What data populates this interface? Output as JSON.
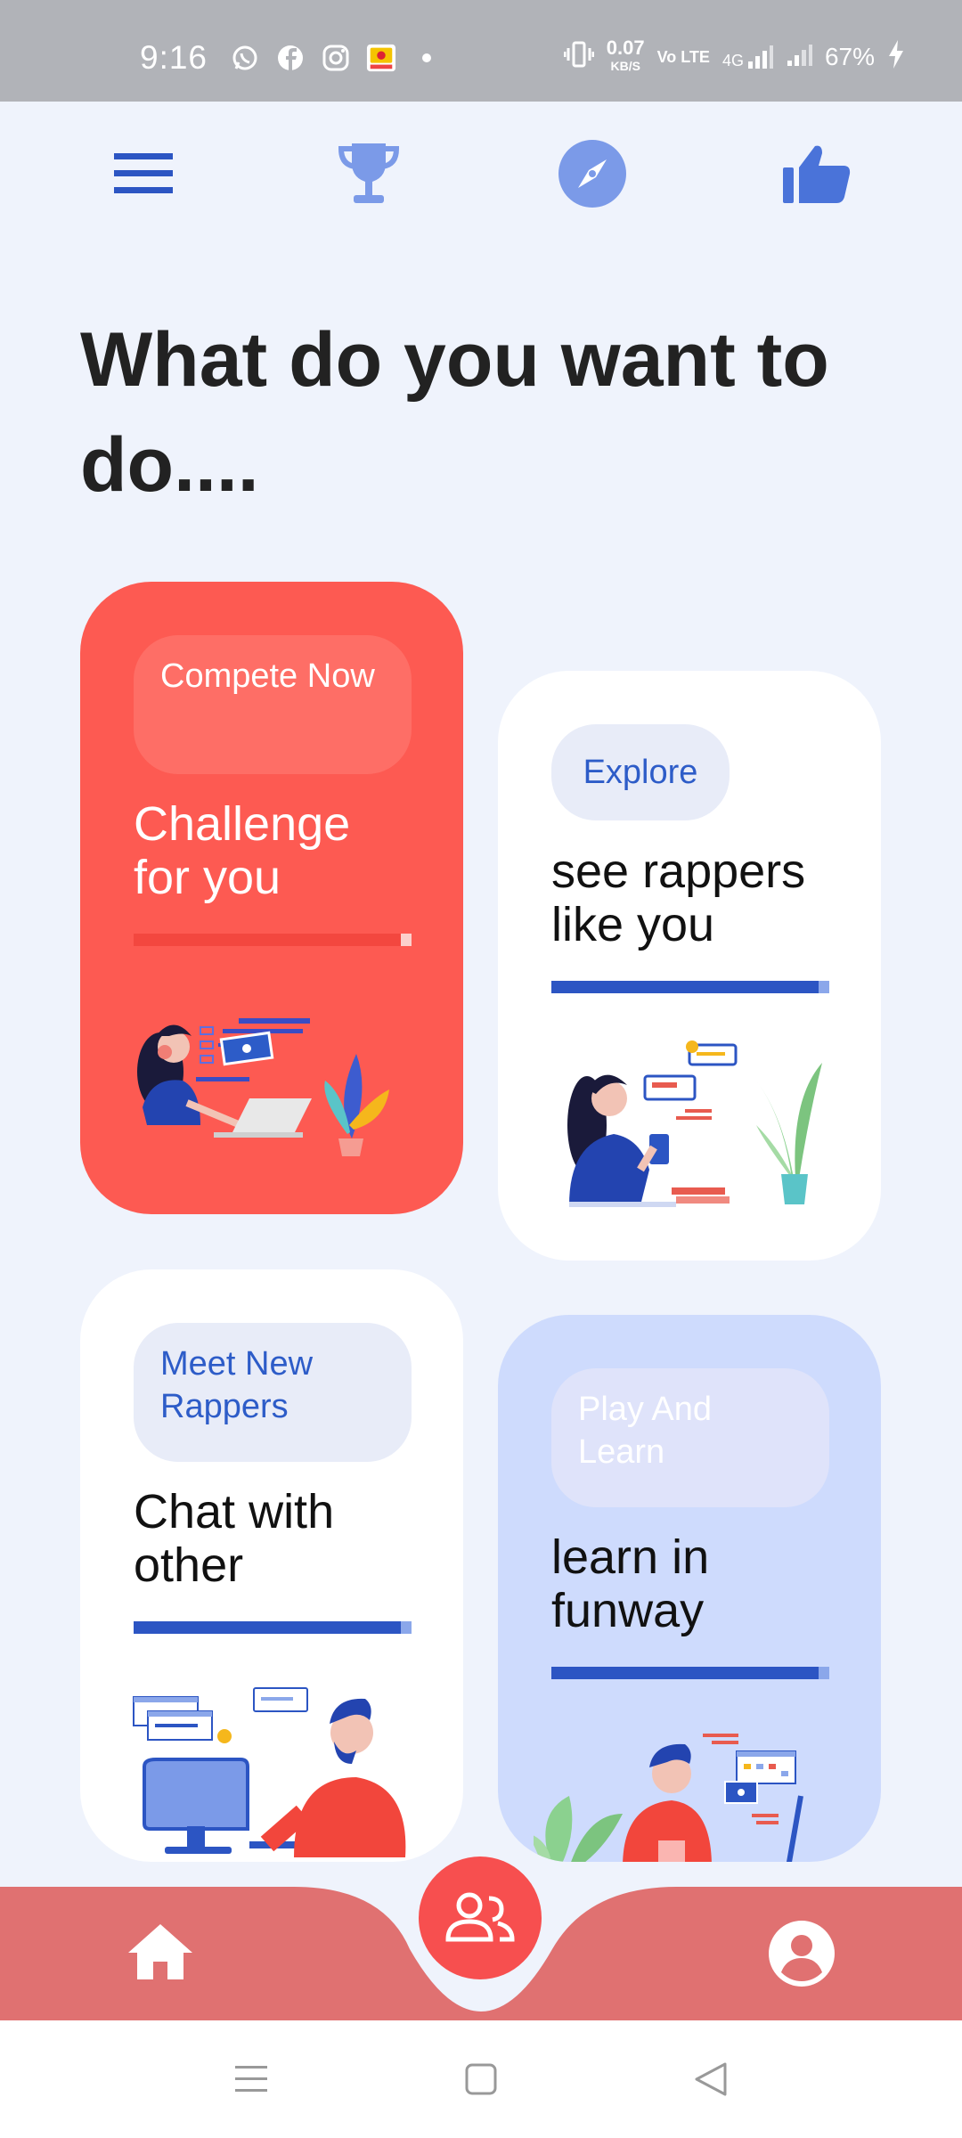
{
  "status_bar": {
    "time": "9:16",
    "notification_icons": [
      "whatsapp-icon",
      "facebook-icon",
      "instagram-icon",
      "app-icon",
      "dot-icon"
    ],
    "net_speed_value": "0.07",
    "net_speed_unit": "KB/S",
    "volte": "Vo LTE",
    "network": "4G",
    "battery": "67%"
  },
  "top_nav": {
    "icons": [
      "menu-icon",
      "trophy-icon",
      "compass-icon",
      "thumbs-up-icon"
    ]
  },
  "heading": "What do you want to do....",
  "cards": [
    {
      "pill": "Compete Now",
      "title": "Challenge for you",
      "color": "#fd5a52"
    },
    {
      "pill": "Explore",
      "title": "see rappers like you",
      "color": "#ffffff"
    },
    {
      "pill": "Meet New Rappers",
      "title": "Chat with other",
      "color": "#ffffff"
    },
    {
      "pill": "Play And Learn",
      "title": "learn in funway",
      "color": "#cedbfd"
    }
  ],
  "bottom_nav": {
    "bar_color": "#e07171",
    "fab_color": "#f74f4f",
    "icons": [
      "home-icon",
      "people-icon",
      "account-circle-icon"
    ]
  },
  "system_nav": {
    "icons": [
      "recents-icon",
      "home-square-icon",
      "back-icon"
    ]
  }
}
